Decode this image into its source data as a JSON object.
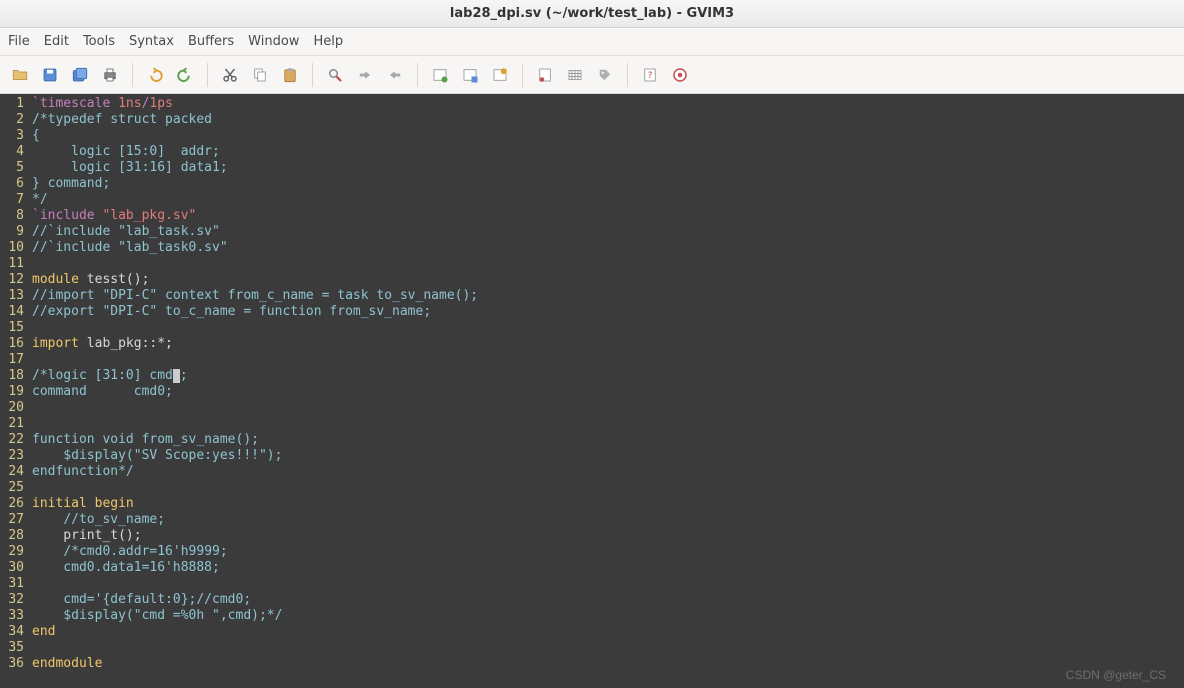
{
  "window": {
    "title": "lab28_dpi.sv (~/work/test_lab) - GVIM3"
  },
  "menubar": {
    "items": [
      "File",
      "Edit",
      "Tools",
      "Syntax",
      "Buffers",
      "Window",
      "Help"
    ]
  },
  "toolbar": {
    "groups": [
      [
        "open-icon",
        "save-icon",
        "saveall-icon",
        "print-icon"
      ],
      [
        "undo-icon",
        "redo-icon"
      ],
      [
        "cut-icon",
        "copy-icon",
        "paste-icon"
      ],
      [
        "findreplace-icon",
        "findnext-icon",
        "findprev-icon"
      ],
      [
        "newsession-icon",
        "opensession-icon",
        "savesession-icon"
      ],
      [
        "script-icon",
        "make-icon",
        "tags-icon"
      ],
      [
        "help-icon",
        "findhelp-icon"
      ]
    ]
  },
  "editor": {
    "cursor_line": 18,
    "lines": [
      {
        "n": 1,
        "tokens": [
          [
            "preproc",
            "`timescale"
          ],
          [
            "ident",
            " "
          ],
          [
            "string",
            "1ns"
          ],
          [
            "preproc",
            "/"
          ],
          [
            "string",
            "1ps"
          ]
        ]
      },
      {
        "n": 2,
        "tokens": [
          [
            "comment",
            "/*typedef struct packed"
          ]
        ]
      },
      {
        "n": 3,
        "tokens": [
          [
            "comment",
            "{"
          ]
        ]
      },
      {
        "n": 4,
        "tokens": [
          [
            "comment",
            "     logic [15:0]  addr;"
          ]
        ]
      },
      {
        "n": 5,
        "tokens": [
          [
            "comment",
            "     logic [31:16] data1;"
          ]
        ]
      },
      {
        "n": 6,
        "tokens": [
          [
            "comment",
            "} command;"
          ]
        ]
      },
      {
        "n": 7,
        "tokens": [
          [
            "comment",
            "*/"
          ]
        ]
      },
      {
        "n": 8,
        "tokens": [
          [
            "preproc",
            "`include "
          ],
          [
            "string",
            "\"lab_pkg.sv\""
          ]
        ]
      },
      {
        "n": 9,
        "tokens": [
          [
            "comment",
            "//`include \"lab_task.sv\""
          ]
        ]
      },
      {
        "n": 10,
        "tokens": [
          [
            "comment",
            "//`include \"lab_task0.sv\""
          ]
        ]
      },
      {
        "n": 11,
        "tokens": []
      },
      {
        "n": 12,
        "tokens": [
          [
            "keyword",
            "module"
          ],
          [
            "ident",
            " tesst();"
          ]
        ]
      },
      {
        "n": 13,
        "tokens": [
          [
            "comment",
            "//import \"DPI-C\" context from_c_name = task to_sv_name();"
          ]
        ]
      },
      {
        "n": 14,
        "tokens": [
          [
            "comment",
            "//export \"DPI-C\" to_c_name = function from_sv_name;"
          ]
        ]
      },
      {
        "n": 15,
        "tokens": []
      },
      {
        "n": 16,
        "tokens": [
          [
            "keyword",
            "import"
          ],
          [
            "ident",
            " lab_pkg::*;"
          ]
        ]
      },
      {
        "n": 17,
        "tokens": []
      },
      {
        "n": 18,
        "tokens": [
          [
            "comment",
            "/*logic [31:0] cmd"
          ],
          [
            "cursor",
            ""
          ],
          [
            "comment",
            ";"
          ]
        ]
      },
      {
        "n": 19,
        "tokens": [
          [
            "comment",
            "command      cmd0;"
          ]
        ]
      },
      {
        "n": 20,
        "tokens": []
      },
      {
        "n": 21,
        "tokens": []
      },
      {
        "n": 22,
        "tokens": [
          [
            "comment",
            "function void from_sv_name();"
          ]
        ]
      },
      {
        "n": 23,
        "tokens": [
          [
            "comment",
            "    $display(\"SV Scope:yes!!!\");"
          ]
        ]
      },
      {
        "n": 24,
        "tokens": [
          [
            "comment",
            "endfunction*/"
          ]
        ]
      },
      {
        "n": 25,
        "tokens": []
      },
      {
        "n": 26,
        "tokens": [
          [
            "keyword",
            "initial begin"
          ]
        ]
      },
      {
        "n": 27,
        "tokens": [
          [
            "ident",
            "    "
          ],
          [
            "comment",
            "//to_sv_name;"
          ]
        ]
      },
      {
        "n": 28,
        "tokens": [
          [
            "ident",
            "    print_t();"
          ]
        ]
      },
      {
        "n": 29,
        "tokens": [
          [
            "ident",
            "    "
          ],
          [
            "comment",
            "/*cmd0.addr=16'h9999;"
          ]
        ]
      },
      {
        "n": 30,
        "tokens": [
          [
            "comment",
            "    cmd0.data1=16'h8888;"
          ]
        ]
      },
      {
        "n": 31,
        "tokens": []
      },
      {
        "n": 32,
        "tokens": [
          [
            "comment",
            "    cmd='{default:0};//cmd0;"
          ]
        ]
      },
      {
        "n": 33,
        "tokens": [
          [
            "comment",
            "    $display(\"cmd =%0h \",cmd);*/"
          ]
        ]
      },
      {
        "n": 34,
        "tokens": [
          [
            "keyword",
            "end"
          ]
        ]
      },
      {
        "n": 35,
        "tokens": []
      },
      {
        "n": 36,
        "tokens": [
          [
            "keyword",
            "endmodule"
          ]
        ]
      }
    ]
  },
  "watermark": "CSDN @geter_CS"
}
